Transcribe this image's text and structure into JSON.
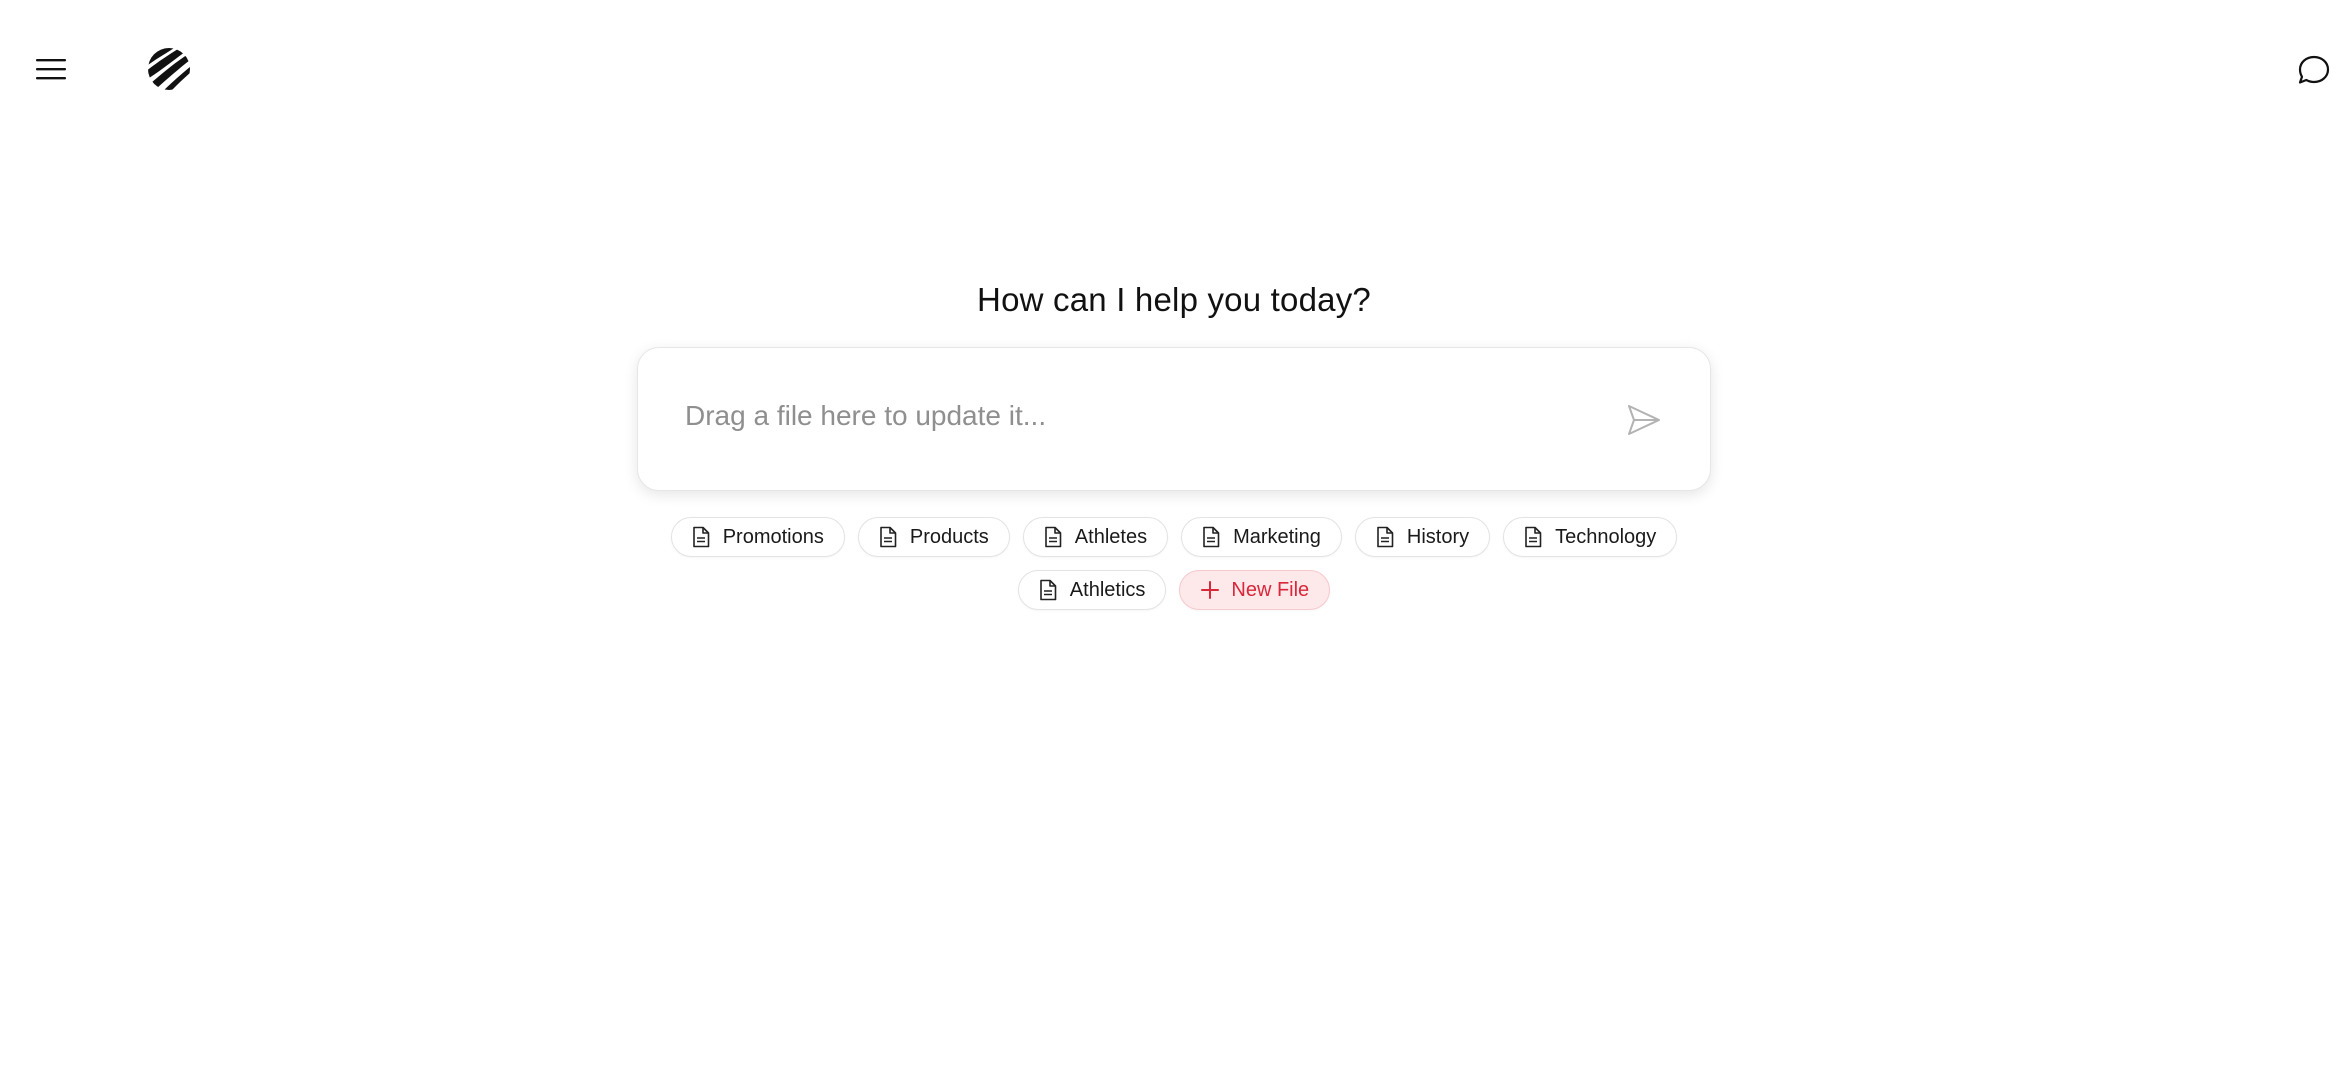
{
  "header": {
    "menu_icon": "hamburger-menu-icon",
    "logo_icon": "striped-globe-logo",
    "chat_icon": "chat-bubble-icon"
  },
  "main": {
    "heading": "How can I help you today?",
    "input": {
      "placeholder": "Drag a file here to update it...",
      "value": ""
    },
    "send_icon": "send-icon",
    "files": [
      {
        "label": "Promotions"
      },
      {
        "label": "Products"
      },
      {
        "label": "Athletes"
      },
      {
        "label": "Marketing"
      },
      {
        "label": "History"
      },
      {
        "label": "Technology"
      },
      {
        "label": "Athletics"
      }
    ],
    "new_file_label": "New File"
  },
  "colors": {
    "accent": "#d8283a",
    "accent_bg": "#fde8ea",
    "text": "#111111",
    "placeholder": "#8f8f8f",
    "border": "#e3e3e3"
  }
}
